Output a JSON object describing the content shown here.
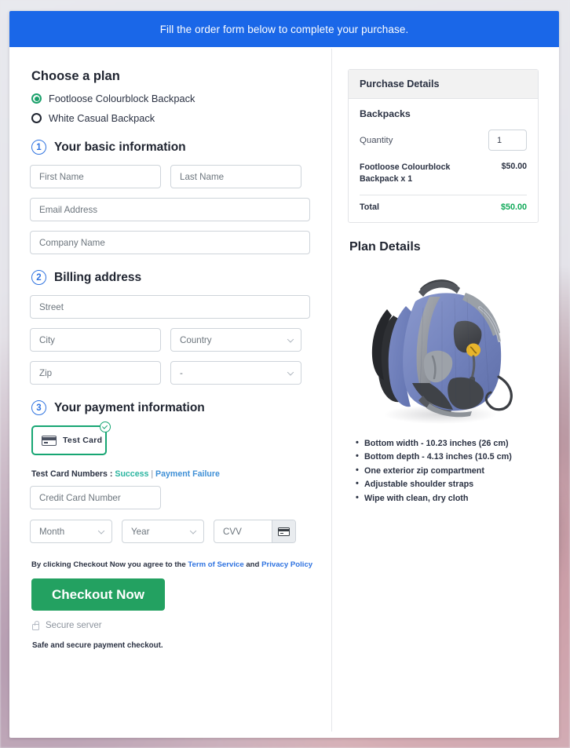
{
  "banner": {
    "text": "Fill the order form below to complete your purchase."
  },
  "plan": {
    "heading": "Choose a plan",
    "options": [
      {
        "label": "Footloose Colourblock Backpack",
        "selected": true
      },
      {
        "label": "White Casual Backpack",
        "selected": false
      }
    ]
  },
  "steps": {
    "basic": {
      "number": "1",
      "title": "Your basic information"
    },
    "billing": {
      "number": "2",
      "title": "Billing address"
    },
    "payment": {
      "number": "3",
      "title": "Your payment information"
    }
  },
  "fields": {
    "first_name": "First Name",
    "last_name": "Last Name",
    "email": "Email Address",
    "company": "Company Name",
    "street": "Street",
    "city": "City",
    "country": "Country",
    "zip": "Zip",
    "state": "-",
    "credit_card": "Credit Card Number",
    "month": "Month",
    "year": "Year",
    "cvv": "CVV"
  },
  "payment": {
    "tile_label": "Test  Card",
    "test_prefix": "Test Card Numbers :",
    "link_success": "Success",
    "separator": "|",
    "link_failure": "Payment Failure"
  },
  "footer": {
    "terms_prefix": "By clicking Checkout Now you agree to the",
    "terms_link": "Term of Service",
    "terms_and": "and",
    "privacy_link": "Privacy Policy",
    "checkout_label": "Checkout Now",
    "secure_server": "Secure server",
    "safe_note": "Safe and secure payment checkout."
  },
  "purchase_details": {
    "header": "Purchase Details",
    "group": "Backpacks",
    "quantity_label": "Quantity",
    "quantity_value": "1",
    "line_item": "Footloose Colourblock Backpack x 1",
    "line_price": "$50.00",
    "total_label": "Total",
    "total_value": "$50.00"
  },
  "plan_details": {
    "heading": "Plan Details",
    "image_alt": "backpack-product-photo",
    "bullets": [
      "Bottom width - 10.23 inches (26 cm)",
      "Bottom depth - 4.13 inches (10.5 cm)",
      "One exterior zip compartment",
      "Adjustable shoulder straps",
      "Wipe with clean, dry cloth"
    ]
  },
  "colors": {
    "banner_blue": "#1a67e8",
    "accent_green": "#23a161",
    "total_green": "#0fa958",
    "link_blue": "#2f73e0",
    "success_teal": "#2bb5a0"
  }
}
